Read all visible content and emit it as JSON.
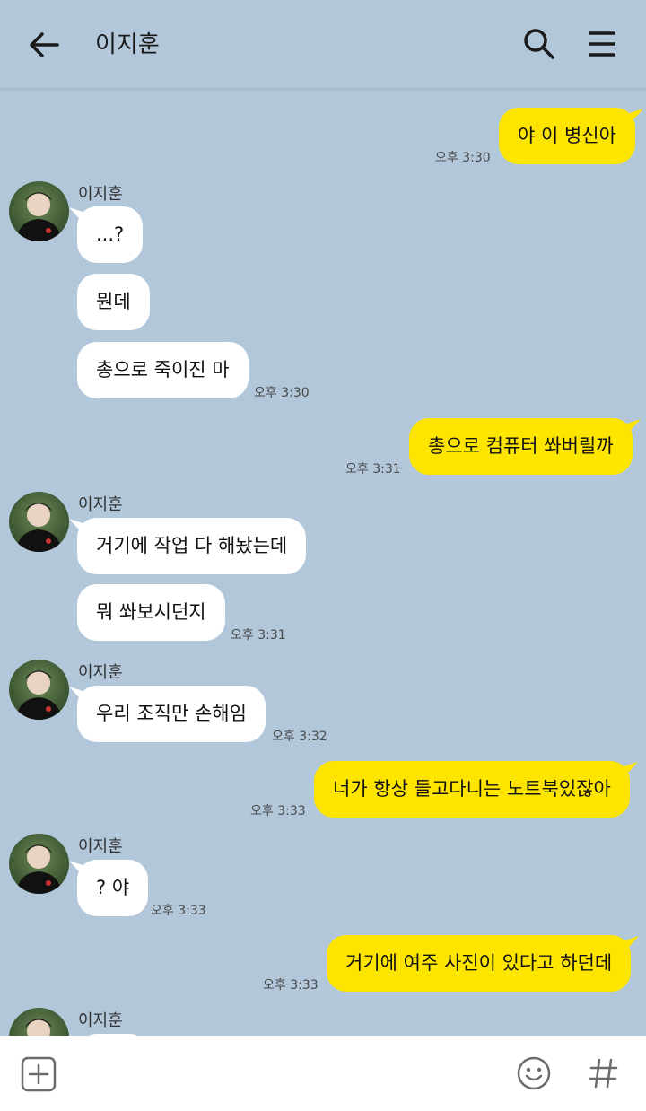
{
  "header": {
    "title": "이지훈",
    "back_icon": "arrow-left-icon",
    "search_icon": "search-icon",
    "menu_icon": "hamburger-menu-icon"
  },
  "colors": {
    "background": "#b2c7da",
    "my_bubble": "#fee500",
    "their_bubble": "#ffffff"
  },
  "messages": [
    {
      "from": "me",
      "text": "야 이 병신아",
      "time": "오후 3:30"
    },
    {
      "from": "them",
      "sender": "이지훈",
      "text": "...?"
    },
    {
      "from": "them",
      "text": "뭔데"
    },
    {
      "from": "them",
      "text": "총으로 죽이진 마",
      "time": "오후 3:30"
    },
    {
      "from": "me",
      "text": "총으로 컴퓨터 쏴버릴까",
      "time": "오후 3:31"
    },
    {
      "from": "them",
      "sender": "이지훈",
      "text": "거기에 작업 다 해놨는데"
    },
    {
      "from": "them",
      "text": "뭐 쏴보시던지",
      "time": "오후 3:31"
    },
    {
      "from": "them",
      "sender": "이지훈",
      "text": "우리 조직만 손해임",
      "time": "오후 3:32"
    },
    {
      "from": "me",
      "text": "너가 항상 들고다니는 노트북있잖아",
      "time": "오후 3:33"
    },
    {
      "from": "them",
      "sender": "이지훈",
      "text": "? 야",
      "time": "오후 3:33"
    },
    {
      "from": "me",
      "text": "거기에 여주 사진이 있다고 하던데",
      "time": "오후 3:33"
    },
    {
      "from": "them",
      "sender": "이지훈",
      "text": ""
    }
  ],
  "bottom": {
    "attach_icon": "plus-square-icon",
    "emoji_icon": "smiley-icon",
    "hashtag_icon": "hashtag-icon"
  }
}
